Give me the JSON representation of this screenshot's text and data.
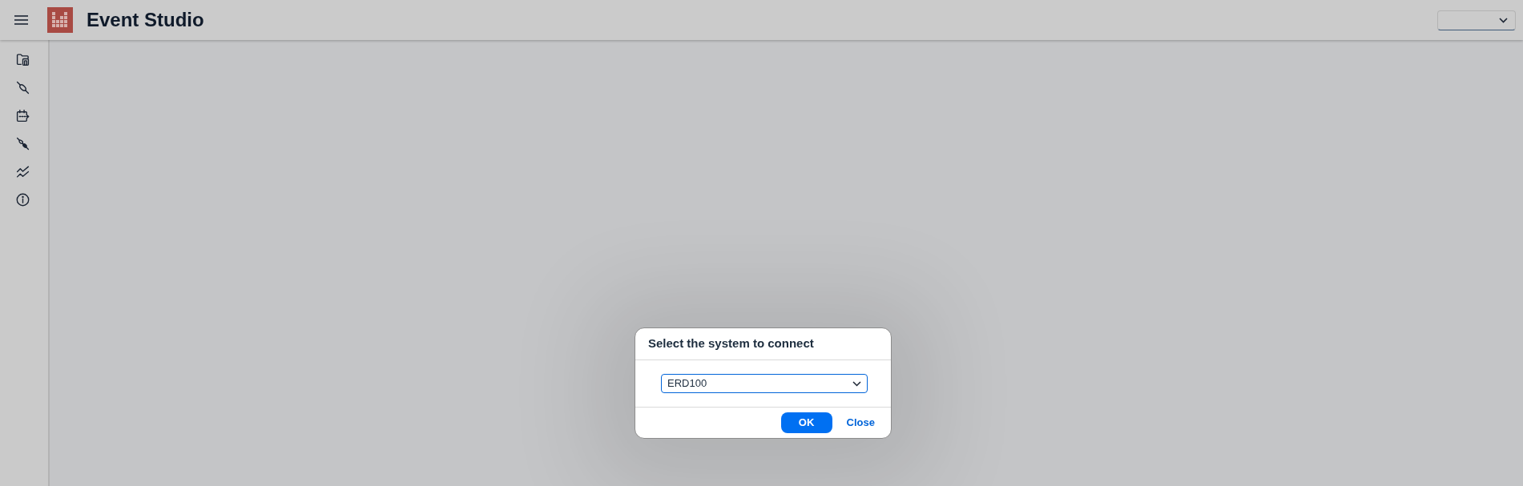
{
  "header": {
    "title": "Event Studio"
  },
  "dialog": {
    "title": "Select the system to connect",
    "select": {
      "value": "ERD100"
    },
    "buttons": [
      {
        "label": "OK",
        "kind": "primary"
      },
      {
        "label": "Close",
        "kind": "transparent"
      }
    ]
  }
}
